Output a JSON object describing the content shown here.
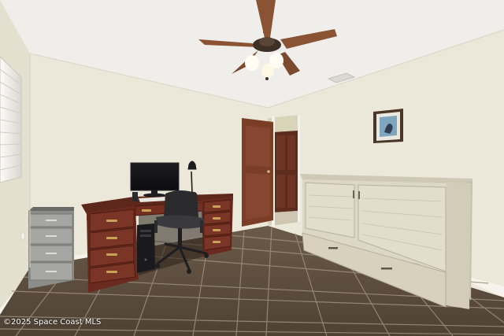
{
  "photo": {
    "watermark": "©2025 Space Coast MLS"
  },
  "colors": {
    "ceiling": "#efeeea",
    "wall_left": "#e7e3d2",
    "wall_back": "#ece8d9",
    "wall_right": "#ece9db",
    "floor_tile": "#5b4c3e",
    "grout": "#9a8d7d",
    "door_wood": "#7a3e26",
    "desk_wood": "#6a2b1e",
    "cabinet_white": "#ddd7c6",
    "fan_blade": "#8a5334",
    "file_cabinet": "#8f8f8c"
  }
}
